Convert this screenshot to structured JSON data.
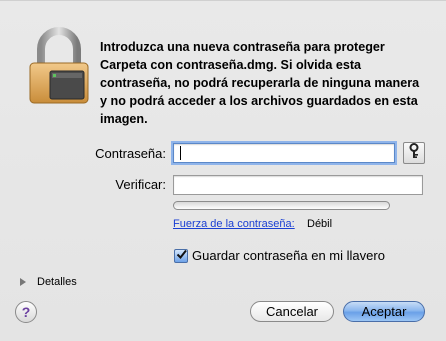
{
  "dialog": {
    "message": "Introduzca una nueva contraseña para proteger Carpeta con contraseña.dmg. Si olvida esta contraseña, no podrá recuperarla de ninguna manera y no podrá acceder a los archivos guardados en esta imagen."
  },
  "password": {
    "label": "Contraseña:",
    "value": "",
    "key_icon": "key-icon"
  },
  "verify": {
    "label": "Verificar:",
    "value": ""
  },
  "strength": {
    "link_text": "Fuerza de la contraseña:",
    "value": "Débil",
    "level": 0
  },
  "keychain": {
    "label": "Guardar contraseña en mi llavero",
    "checked": true
  },
  "details": {
    "label": "Detalles"
  },
  "buttons": {
    "help": "?",
    "cancel": "Cancelar",
    "accept": "Aceptar"
  },
  "colors": {
    "accent": "#6aa0e8",
    "link": "#1a3fd3"
  }
}
